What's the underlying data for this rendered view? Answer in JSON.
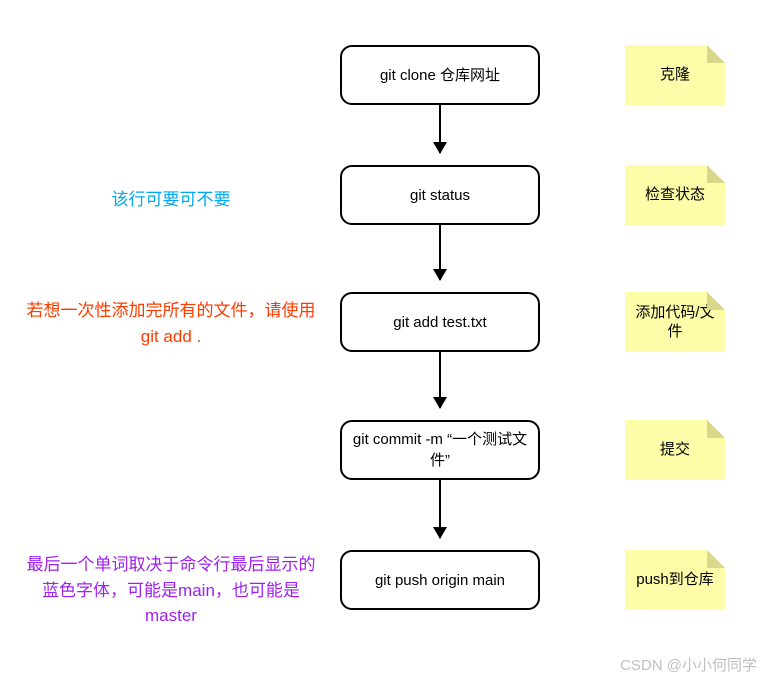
{
  "steps": [
    {
      "command": "git clone 仓库网址",
      "sticky": "克隆",
      "note": null,
      "note_color": null
    },
    {
      "command": "git status",
      "sticky": "检查状态",
      "note": "该行可要可不要",
      "note_color": "blue"
    },
    {
      "command": "git add test.txt",
      "sticky": "添加代码/文件",
      "note": "若想一次性添加完所有的文件，请使用git add .",
      "note_color": "red"
    },
    {
      "command": "git commit -m “一个测试文件”",
      "sticky": "提交",
      "note": null,
      "note_color": null
    },
    {
      "command": "git push origin main",
      "sticky": "push到仓库",
      "note": "最后一个单词取决于命令行最后显示的蓝色字体，可能是main，也可能是master",
      "note_color": "purple"
    }
  ],
  "watermark": "CSDN @小小何同学",
  "layout": {
    "tops": [
      45,
      165,
      292,
      420,
      550
    ],
    "arrow_tops": [
      105,
      225,
      352,
      480
    ],
    "arrow_heights": [
      48,
      55,
      56,
      58
    ],
    "note_tops": [
      0,
      187,
      298,
      0,
      552
    ]
  }
}
